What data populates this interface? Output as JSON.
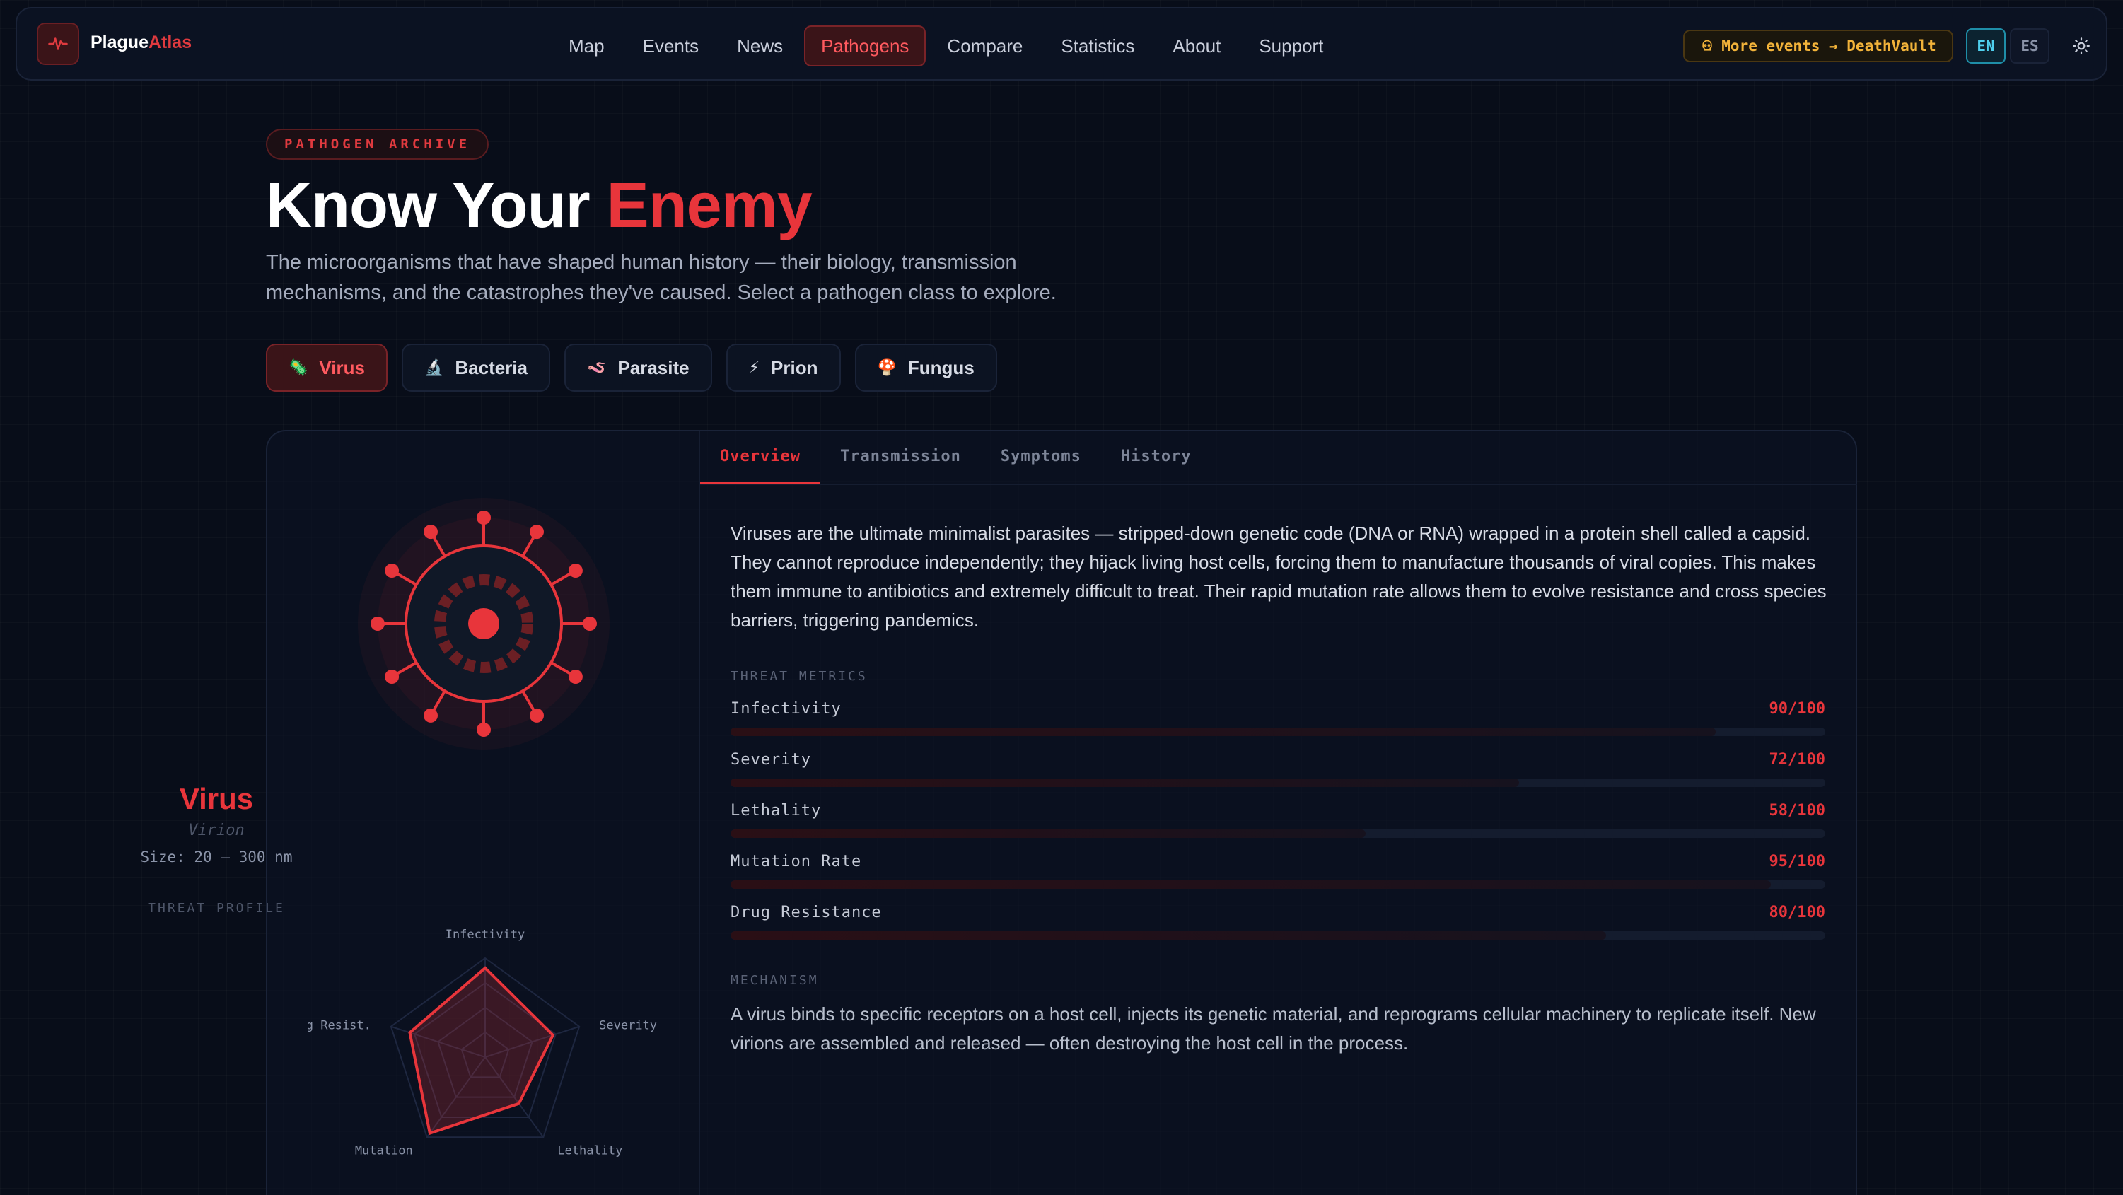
{
  "nav": {
    "brand_part1": "Plague",
    "brand_part2": "Atlas",
    "links": [
      {
        "label": "Map"
      },
      {
        "label": "Events"
      },
      {
        "label": "News"
      },
      {
        "label": "Pathogens",
        "active": true
      },
      {
        "label": "Compare"
      },
      {
        "label": "Statistics"
      },
      {
        "label": "About"
      },
      {
        "label": "Support"
      }
    ],
    "events_pill": "More events → DeathVault",
    "lang_en": "EN",
    "lang_es": "ES"
  },
  "hero": {
    "badge": "PATHOGEN ARCHIVE",
    "title_part1": "Know Your ",
    "title_part2": "Enemy",
    "subtitle": "The microorganisms that have shaped human history — their biology, transmission mechanisms, and the catastrophes they've caused. Select a pathogen class to explore."
  },
  "filters": [
    {
      "emoji": "🦠",
      "label": "Virus",
      "active": true
    },
    {
      "emoji": "🔬",
      "label": "Bacteria"
    },
    {
      "emoji": "🪱",
      "label": "Parasite"
    },
    {
      "emoji": "⚡",
      "label": "Prion"
    },
    {
      "emoji": "🍄",
      "label": "Fungus"
    }
  ],
  "pathogen": {
    "name": "Virus",
    "scientific": "Virion",
    "size": "Size: 20 – 300 nm",
    "threat_profile_label": "THREAT PROFILE",
    "radar_axes": [
      "Infectivity",
      "Severity",
      "Lethality",
      "Mutation",
      "g Resist."
    ],
    "radar_values": [
      90,
      72,
      58,
      95,
      80
    ]
  },
  "tabs": [
    {
      "label": "Overview",
      "active": true
    },
    {
      "label": "Transmission"
    },
    {
      "label": "Symptoms"
    },
    {
      "label": "History"
    }
  ],
  "overview": {
    "text": "Viruses are the ultimate minimalist parasites — stripped-down genetic code (DNA or RNA) wrapped in a protein shell called a capsid. They cannot reproduce independently; they hijack living host cells, forcing them to manufacture thousands of viral copies. This makes them immune to antibiotics and extremely difficult to treat. Their rapid mutation rate allows them to evolve resistance and cross species barriers, triggering pandemics.",
    "metrics_label": "THREAT METRICS",
    "metrics": [
      {
        "label": "Infectivity",
        "value": "90/100",
        "fraction": 0.9
      },
      {
        "label": "Severity",
        "value": "72/100",
        "fraction": 0.72
      },
      {
        "label": "Lethality",
        "value": "58/100",
        "fraction": 0.58
      },
      {
        "label": "Mutation Rate",
        "value": "95/100",
        "fraction": 0.95
      },
      {
        "label": "Drug Resistance",
        "value": "80/100",
        "fraction": 0.8
      }
    ],
    "mechanism_label": "MECHANISM",
    "mechanism_text": "A virus binds to specific receptors on a host cell, injects its genetic material, and reprograms cellular machinery to replicate itself. New virions are assembled and released — often destroying the host cell in the process."
  },
  "colors": {
    "accent": "#e8353b",
    "background": "#080d19",
    "events": "#f2b33a",
    "lang_active": "#4fd0ee"
  }
}
